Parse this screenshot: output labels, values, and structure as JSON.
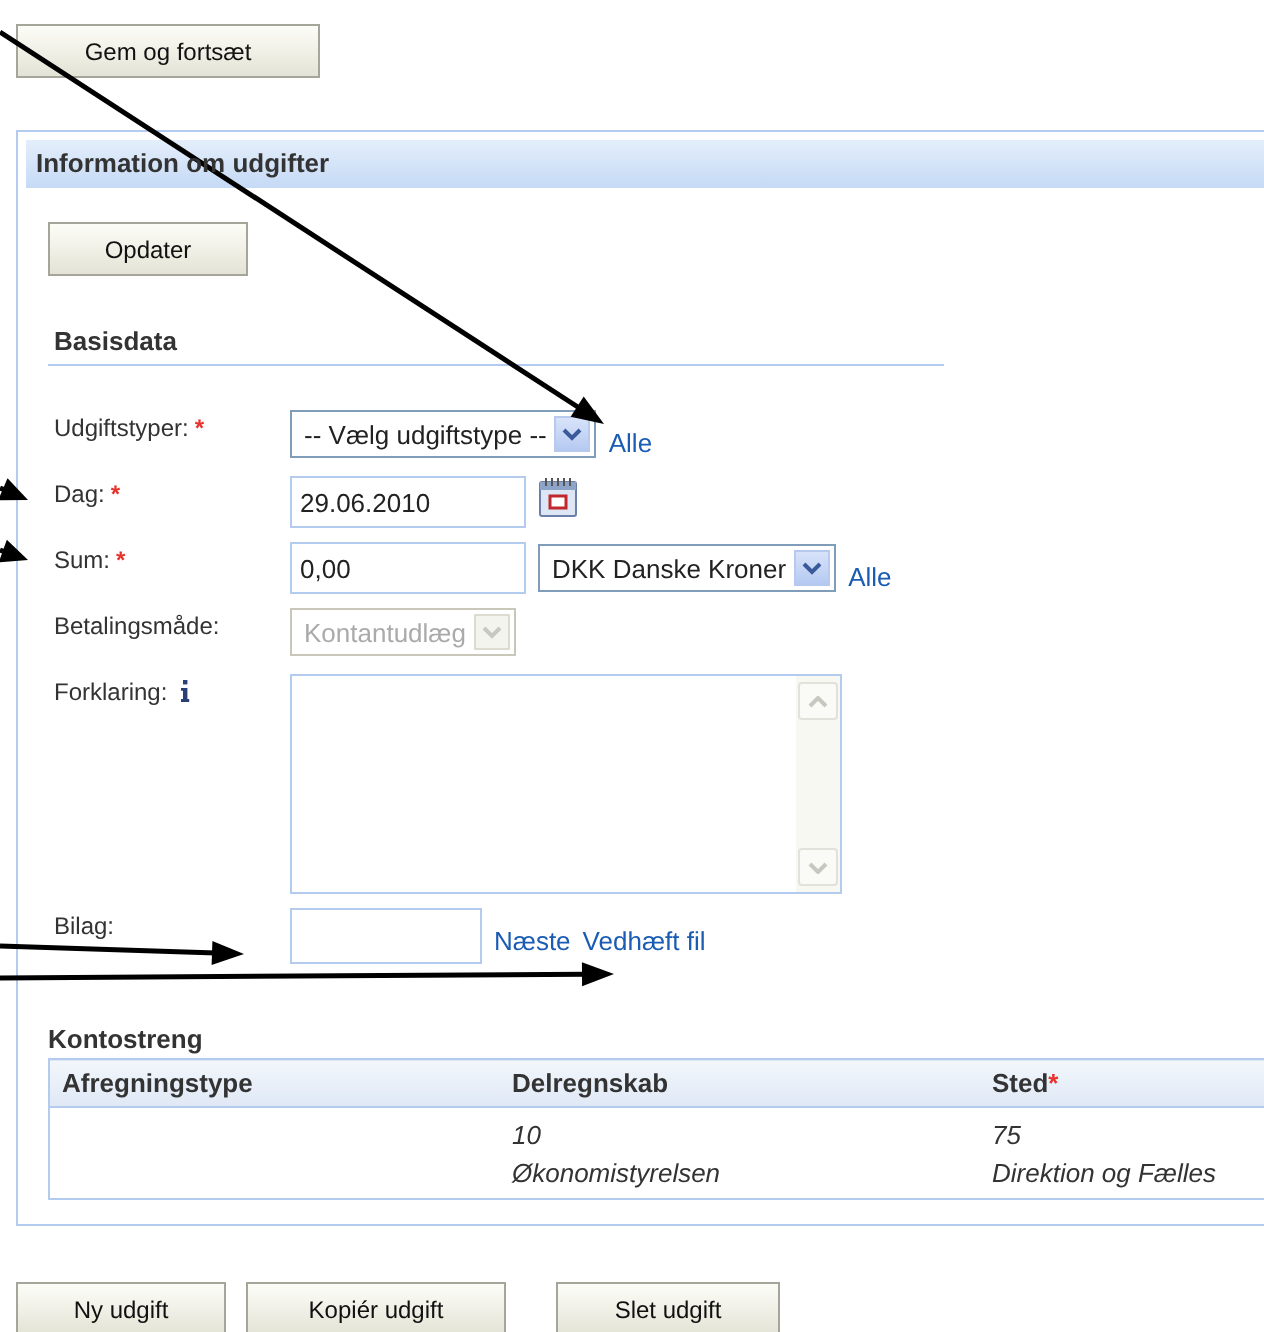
{
  "top_button": "Gem og fortsæt",
  "panel": {
    "title": "Information om udgifter",
    "update_button": "Opdater",
    "section_title": "Basisdata",
    "fields": [
      {
        "label": "Udgiftstyper:",
        "required_mark": "*",
        "kind": "select",
        "value": "-- Vælg udgiftstype --",
        "disabled": false,
        "links": [
          "Alle"
        ]
      },
      {
        "label": "Dag:",
        "required_mark": "*",
        "kind": "date",
        "value": "29.06.2010"
      },
      {
        "label": "Sum:",
        "required_mark": "*",
        "kind": "amount",
        "value": "0,00",
        "currency": "DKK Danske Kroner",
        "links": [
          "Alle"
        ]
      },
      {
        "label": "Betalingsmåde:",
        "kind": "select",
        "value": "Kontantudlæg",
        "disabled": true
      },
      {
        "label": "Forklaring:",
        "kind": "textarea",
        "info": true
      },
      {
        "label": "Bilag:",
        "kind": "attachment",
        "links": [
          "Næste",
          "Vedhæft fil"
        ]
      }
    ],
    "kontostreng": {
      "title": "Kontostreng",
      "columns": [
        {
          "label": "Afregningstype"
        },
        {
          "label": "Delregnskab"
        },
        {
          "label": "Sted",
          "required_mark": "*"
        }
      ],
      "rows": [
        {
          "cells": [
            {},
            {
              "lines": [
                "10",
                "Økonomistyrelsen"
              ]
            },
            {
              "lines": [
                "75",
                "Direktion og Fælles"
              ]
            }
          ]
        }
      ]
    }
  },
  "bottom_buttons": [
    "Ny udgift",
    "Kopiér udgift",
    "Slet udgift"
  ]
}
